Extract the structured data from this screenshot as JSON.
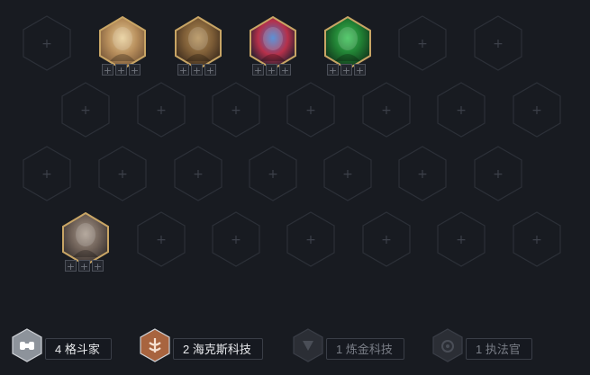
{
  "board": {
    "champions": [
      {
        "name": "champion-portrait-golden-mage",
        "slot_row": 0,
        "slot_col": 1,
        "stars": [
          "+",
          "+",
          "+"
        ],
        "tint": [
          "#e8cf9a",
          "#b68d5b",
          "#7b5a3a"
        ]
      },
      {
        "name": "champion-portrait-stone-brute",
        "slot_row": 0,
        "slot_col": 2,
        "stars": [
          "+",
          "+",
          "+"
        ],
        "tint": [
          "#b39059",
          "#7c5c36",
          "#3d2c1d"
        ]
      },
      {
        "name": "champion-portrait-crystal-beast",
        "slot_row": 0,
        "slot_col": 3,
        "stars": [
          "+",
          "+",
          "+"
        ],
        "tint": [
          "#3f7fd0",
          "#b6304a",
          "#1c1f2f"
        ]
      },
      {
        "name": "champion-portrait-green-monster",
        "slot_row": 0,
        "slot_col": 4,
        "stars": [
          "+",
          "+",
          "+"
        ],
        "tint": [
          "#3cc257",
          "#1f7a31",
          "#12361c"
        ]
      },
      {
        "name": "champion-portrait-grey-brawler",
        "slot_row": 3,
        "slot_col": 0,
        "stars": [
          "+",
          "+",
          "+"
        ],
        "tint": [
          "#a99b8e",
          "#6f6158",
          "#3b3431"
        ]
      }
    ],
    "empty_slot_symbol": "+"
  },
  "traits": [
    {
      "count": "4",
      "name": "格斗家",
      "text": "4 格斗家",
      "state": "active",
      "hex_color": "#8d939b",
      "icon": "fist-icon"
    },
    {
      "count": "2",
      "name": "海克斯科技",
      "text": "2 海克斯科技",
      "state": "active",
      "hex_color": "#a8643f",
      "icon": "hextech-icon"
    },
    {
      "count": "1",
      "name": "炼金科技",
      "text": "1 炼金科技",
      "state": "inactive",
      "hex_color": "#2b2e35",
      "icon": "chemtech-icon"
    },
    {
      "count": "1",
      "name": "执法官",
      "text": "1 执法官",
      "state": "inactive",
      "hex_color": "#2b2e35",
      "icon": "enforcer-icon"
    }
  ],
  "colors": {
    "background": "#181b21",
    "slot_border": "#2c3038",
    "portrait_frame": "#c8a565"
  }
}
